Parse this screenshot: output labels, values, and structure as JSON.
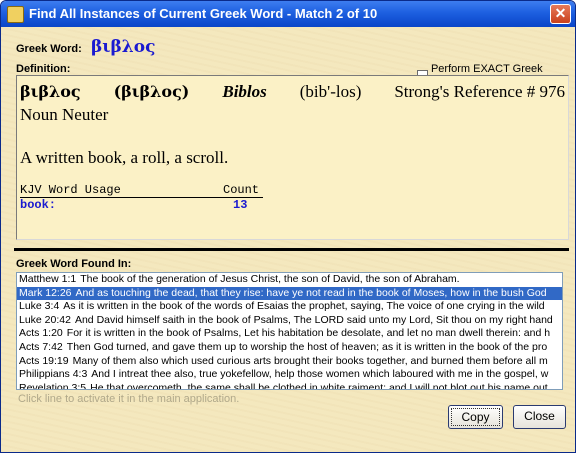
{
  "window": {
    "title": "Find All Instances of Current Greek Word - Match 2 of 10",
    "close_glyph": "✕"
  },
  "labels": {
    "greek_word": "Greek Word:",
    "definition": "Definition:",
    "found_in": "Greek Word Found In:",
    "exact_match": "Perform EXACT Greek match",
    "hint": "Click line to activate it in the main application."
  },
  "greek_word": "βιβλος",
  "definition": {
    "greek": "βιβλος",
    "greek_paren": "(βιβλος)",
    "transliteration": "Biblos",
    "pronunciation": "(bib'-los)",
    "strongs": "Strong's Reference # 976",
    "part_of_speech": "Noun Neuter",
    "meaning": "A written book, a roll, a scroll.",
    "usage_header_word": "KJV Word Usage",
    "usage_header_count": "Count",
    "usage": [
      {
        "word": "book:",
        "count": "13"
      }
    ]
  },
  "verses": [
    {
      "ref": "Matthew 1:1",
      "text": "The book of the generation of Jesus Christ, the son of David, the son of Abraham.",
      "selected": false
    },
    {
      "ref": "Mark 12:26",
      "text": "And as touching the dead, that they rise: have ye not read in the book of Moses, how in the bush God",
      "selected": true
    },
    {
      "ref": "Luke 3:4",
      "text": "As it is written in the book of the words of Esaias the prophet, saying, The voice of one crying in the wild",
      "selected": false
    },
    {
      "ref": "Luke 20:42",
      "text": "And David himself saith in the book of Psalms, The LORD said unto my Lord, Sit thou on my right hand",
      "selected": false
    },
    {
      "ref": "Acts 1:20",
      "text": "For it is written in the book of Psalms, Let his habitation be desolate, and let no man dwell therein: and h",
      "selected": false
    },
    {
      "ref": "Acts 7:42",
      "text": "Then God turned, and gave them up to worship the host of heaven; as it is written in the book of the pro",
      "selected": false
    },
    {
      "ref": "Acts 19:19",
      "text": "Many of them also which used curious arts brought their books together, and burned them before all m",
      "selected": false
    },
    {
      "ref": "Philippians 4:3",
      "text": "And I intreat thee also, true yokefellow, help those women which laboured with me in the gospel, w",
      "selected": false
    },
    {
      "ref": "Revelation 3:5",
      "text": "He that overcometh, the same shall be clothed in white raiment; and I will not blot out his name out",
      "selected": false
    }
  ],
  "buttons": {
    "copy": "Copy",
    "close": "Close"
  },
  "colors": {
    "selection": "#3169c6",
    "greek_word": "#1a1ad0",
    "background": "#f4e8be"
  }
}
